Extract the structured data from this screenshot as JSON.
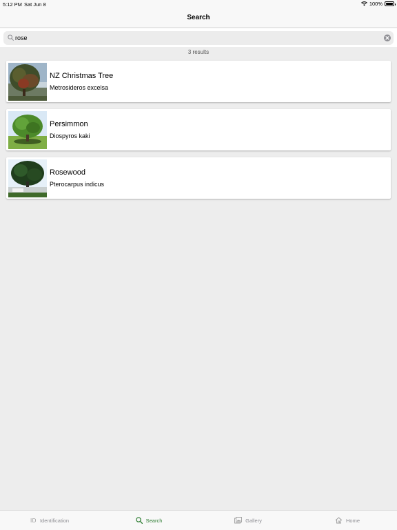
{
  "status_bar": {
    "time": "5:12 PM",
    "date": "Sat Jun 8",
    "battery": "100%"
  },
  "nav": {
    "title": "Search"
  },
  "search": {
    "value": "rose",
    "placeholder": ""
  },
  "results": {
    "count_label": "3 results",
    "items": [
      {
        "title": "NZ Christmas Tree",
        "subtitle": "Metrosideros excelsa"
      },
      {
        "title": "Persimmon",
        "subtitle": "Diospyros kaki"
      },
      {
        "title": "Rosewood",
        "subtitle": "Pterocarpus indicus"
      }
    ]
  },
  "tabs": [
    {
      "label": "Identification",
      "icon": "id-icon",
      "glyph": "ID",
      "active": false
    },
    {
      "label": "Search",
      "icon": "search-icon",
      "active": true
    },
    {
      "label": "Gallery",
      "icon": "gallery-icon",
      "active": false
    },
    {
      "label": "Home",
      "icon": "home-icon",
      "active": false
    }
  ],
  "colors": {
    "accent": "#2d7d32",
    "inactive": "#8e8e93",
    "background": "#ededed"
  }
}
